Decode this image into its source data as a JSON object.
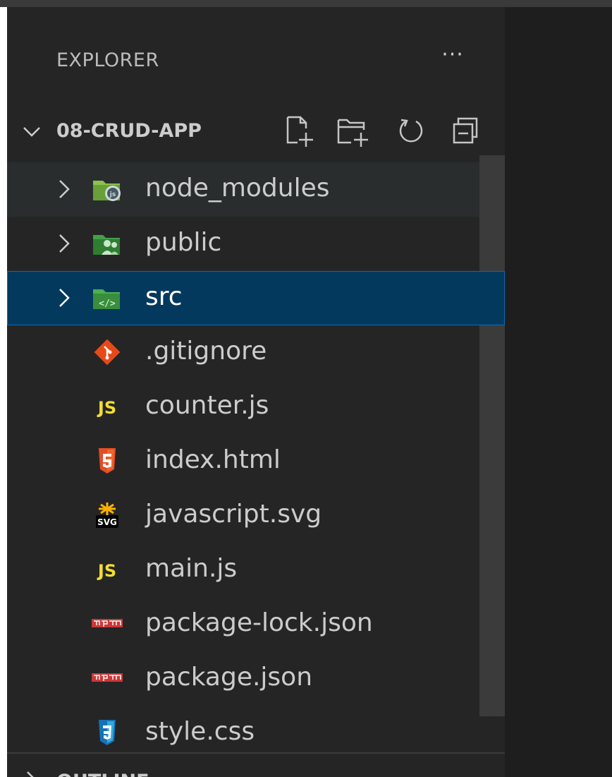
{
  "explorer": {
    "title": "EXPLORER",
    "more_actions": "···"
  },
  "project": {
    "name": "08-CRUD-APP",
    "actions": [
      "new-file",
      "new-folder",
      "refresh",
      "collapse-all"
    ]
  },
  "tree": [
    {
      "name": "node_modules",
      "kind": "folder",
      "icon": "nodejs-folder-icon",
      "state": "hover"
    },
    {
      "name": "public",
      "kind": "folder",
      "icon": "public-folder-icon",
      "state": ""
    },
    {
      "name": "src",
      "kind": "folder",
      "icon": "src-folder-icon",
      "state": "selected"
    },
    {
      "name": ".gitignore",
      "kind": "file",
      "icon": "git-icon",
      "state": ""
    },
    {
      "name": "counter.js",
      "kind": "file",
      "icon": "javascript-icon",
      "state": ""
    },
    {
      "name": "index.html",
      "kind": "file",
      "icon": "html5-icon",
      "state": ""
    },
    {
      "name": "javascript.svg",
      "kind": "file",
      "icon": "svg-icon",
      "state": ""
    },
    {
      "name": "main.js",
      "kind": "file",
      "icon": "javascript-icon",
      "state": ""
    },
    {
      "name": "package-lock.json",
      "kind": "file",
      "icon": "npm-icon",
      "state": ""
    },
    {
      "name": "package.json",
      "kind": "file",
      "icon": "npm-icon",
      "state": ""
    },
    {
      "name": "style.css",
      "kind": "file",
      "icon": "css3-icon",
      "state": ""
    }
  ],
  "outline": {
    "title": "OUTLINE"
  },
  "colors": {
    "sidebar_bg": "#252526",
    "editor_bg": "#1e1e1e",
    "selection_bg": "#04395e",
    "selection_border": "#0a6bb8",
    "hover_bg": "#2a2d2e",
    "text": "#cccccc"
  }
}
